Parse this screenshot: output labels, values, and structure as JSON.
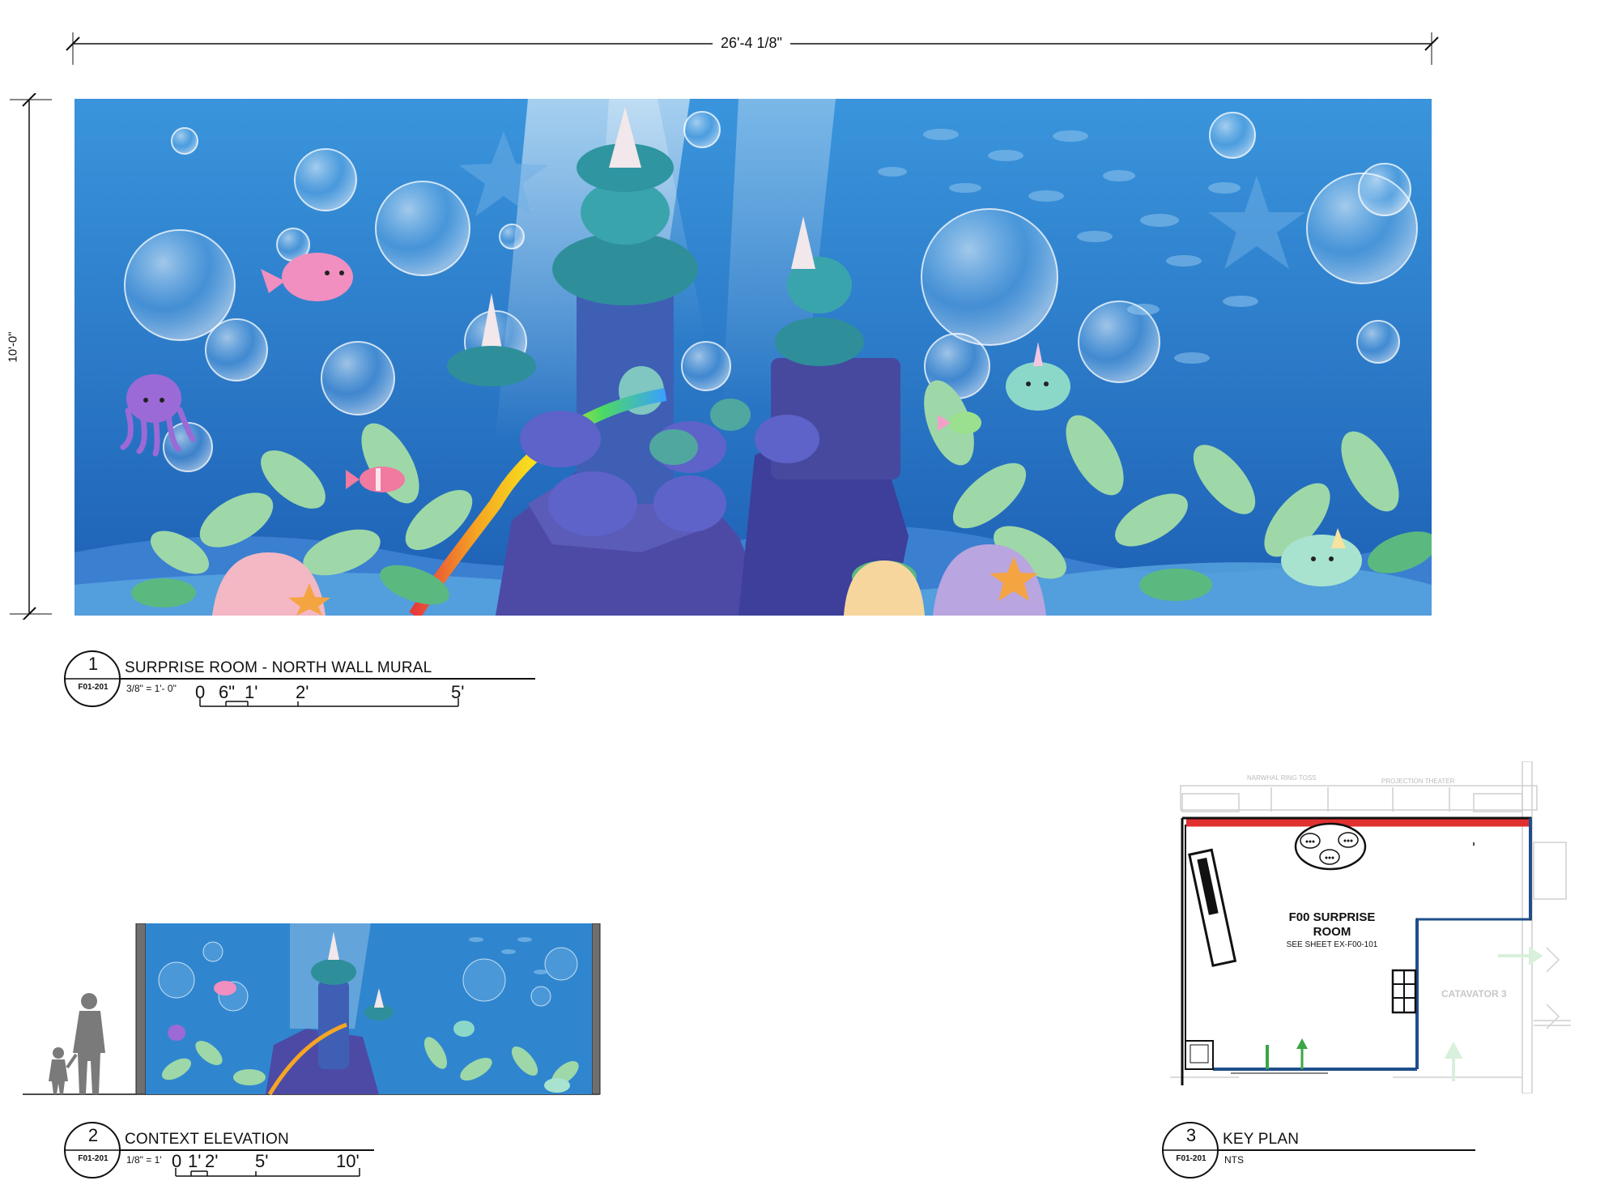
{
  "drawing": {
    "mural_width_dim": "26'-4 1/8\"",
    "mural_height_dim": "10'-0\""
  },
  "view1": {
    "number": "1",
    "sheet_ref": "F01-201",
    "title": "SURPRISE ROOM - NORTH WALL MURAL",
    "scale_label": "3/8\" = 1'- 0\"",
    "scale_ticks": [
      "0",
      "6\"",
      "1'",
      "2'",
      "5'"
    ]
  },
  "view2": {
    "number": "2",
    "sheet_ref": "F01-201",
    "title": "CONTEXT ELEVATION",
    "scale_label": "1/8\" = 1'",
    "scale_ticks": [
      "0",
      "1'",
      "2'",
      "5'",
      "10'"
    ]
  },
  "view3": {
    "number": "3",
    "sheet_ref": "F01-201",
    "title": "KEY PLAN",
    "scale_label": "NTS",
    "room_name_line1": "F00 SURPRISE",
    "room_name_line2": "ROOM",
    "room_note": "SEE SHEET EX-F00-101",
    "label_ring_toss": "NARWHAL RING TOSS",
    "label_theater": "PROJECTION THEATER",
    "label_catavator": "CATAVATOR 3"
  },
  "colors": {
    "water_top": "#2f86cf",
    "water_bottom": "#1e64b8",
    "key_wall_highlight": "#e03030",
    "key_wall_blue": "#1f4e8a"
  }
}
